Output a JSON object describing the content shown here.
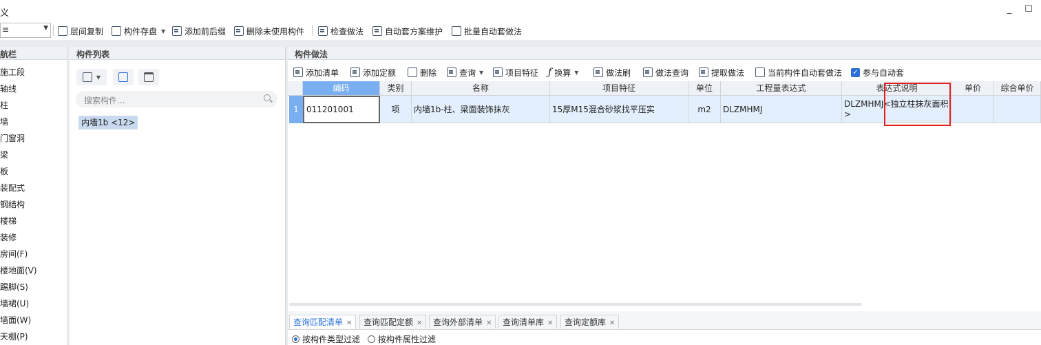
{
  "window": {
    "title": "义",
    "minimize": "_",
    "maximize": "☐"
  },
  "toolbar1": {
    "combo_value": "≡",
    "buttons": [
      "层间复制",
      "构件存盘",
      "添加前后缀",
      "删除未使用构件",
      "检查做法",
      "自动套方案维护",
      "批量自动套做法"
    ]
  },
  "left_panel": {
    "title": "航栏",
    "items": [
      "施工段",
      "轴线",
      "柱",
      "墙",
      "门窗洞",
      "梁",
      "板",
      "装配式",
      "钢结构",
      "楼梯",
      "装修",
      "房间(F)",
      "楼地面(V)",
      "踢脚(S)",
      "墙裙(U)",
      "墙面(W)",
      "天棚(P)"
    ]
  },
  "mid_panel": {
    "title": "构件列表",
    "search_placeholder": "搜索构件...",
    "component": "内墙1b <12>"
  },
  "right_panel": {
    "title": "构件做法",
    "toolbar": [
      "添加清单",
      "添加定额",
      "删除",
      "查询",
      "项目特征",
      "换算",
      "做法刷",
      "做法查询",
      "提取做法",
      "当前构件自动套做法",
      "参与自动套"
    ],
    "columns": [
      "编码",
      "类别",
      "名称",
      "项目特征",
      "单位",
      "工程量表达式",
      "表达式说明",
      "单价",
      "综合单价"
    ],
    "row": {
      "index": "1",
      "code": "011201001",
      "category": "项",
      "name": "内墙1b-柱、梁面装饰抹灰",
      "feature": "15厚M15混合砂浆找平压实",
      "unit": "m2",
      "expr": "DLZMHMJ",
      "expr_desc": "DLZMHMJ<独立柱抹灰面积>",
      "price": "",
      "total_price": ""
    },
    "tabs": [
      "查询匹配清单",
      "查询匹配定额",
      "查询外部清单",
      "查询清单库",
      "查询定额库"
    ],
    "filters": [
      "按构件类型过滤",
      "按构件属性过滤"
    ]
  },
  "colors": {
    "accent": "#2b6fd6",
    "header_selected": "#79aef0",
    "row_bg": "#e3effc",
    "highlight_box": "#e02020"
  }
}
